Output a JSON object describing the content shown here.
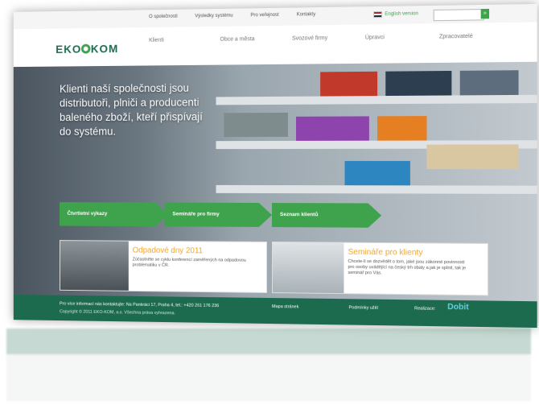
{
  "top": {
    "links": [
      "O společnosti",
      "Výsledky systému",
      "Pro veřejnost",
      "Kontakty"
    ],
    "english": "English version",
    "search_placeholder": "",
    "search_button": "»"
  },
  "header": {
    "logo": "EKO-KOM",
    "nav": [
      "Klienti",
      "Obce a města",
      "Svozové firmy",
      "Úpravci",
      "Zpracovatelé"
    ]
  },
  "hero": {
    "text": "Klienti naší společnosti jsou distributoři, plniči a producenti baleného zboží, kteří přispívají do systému.",
    "buttons": [
      "Čtvrtletní výkazy",
      "Semináře pro firmy",
      "Seznam klientů"
    ]
  },
  "cards": [
    {
      "title": "Odpadové dny 2011",
      "text": "Zúčastněte se cyklu konferencí zaměřených na odpadovou problematiku v ČR."
    },
    {
      "title": "Semináře pro klienty",
      "text": "Chcete-li se dozvědět o tom, jaké jsou zákonné povinnosti pro osoby uvádějící na český trh obaly a jak je splnit, tak je seminář pro Vás."
    }
  ],
  "footer": {
    "line1": "Pro více informací nás kontaktujte: Na Pankráci 17, Praha 4, tel.: +420 261 176 236",
    "line2": "Copyright © 2011 EKO-KOM, a.s. Všechna práva vyhrazena.",
    "link1": "Mapa stránek",
    "link2": "Podmínky užití",
    "realizace": "Realizace:",
    "realizace_logo": "Dobit"
  }
}
